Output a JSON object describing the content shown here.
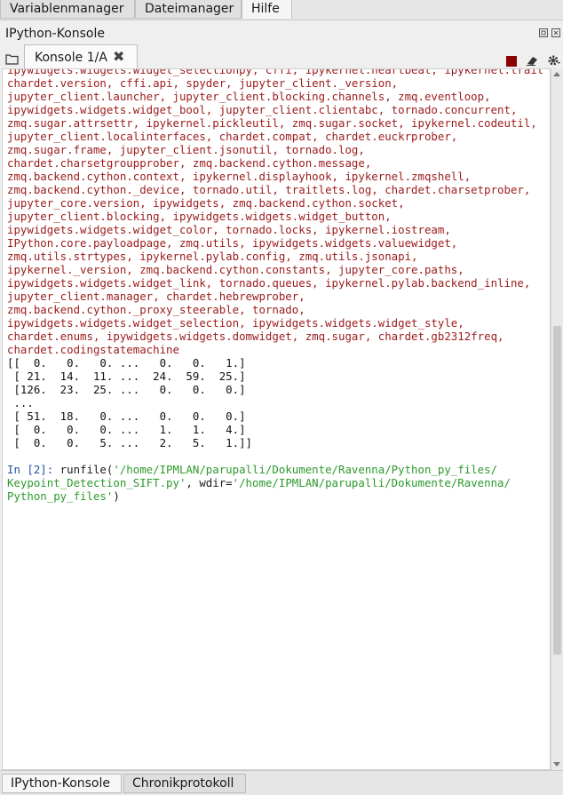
{
  "top_tabs": [
    "Variablenmanager",
    "Dateimanager",
    "Hilfe"
  ],
  "pane": {
    "title": "IPython-Konsole"
  },
  "console_tab": {
    "label": "Konsole 1/A",
    "close": "✖"
  },
  "console": {
    "import_lines": [
      "ipywidgets.widgets.widget_selectionpy, cffi, ipykernel.heartbeat, ipykernel.trait",
      "chardet.version, cffi.api, spyder, jupyter_client._version,",
      "jupyter_client.launcher, jupyter_client.blocking.channels, zmq.eventloop,",
      "ipywidgets.widgets.widget_bool, jupyter_client.clientabc, tornado.concurrent,",
      "zmq.sugar.attrsettr, ipykernel.pickleutil, zmq.sugar.socket, ipykernel.codeutil,",
      "jupyter_client.localinterfaces, chardet.compat, chardet.euckrprober,",
      "zmq.sugar.frame, jupyter_client.jsonutil, tornado.log,",
      "chardet.charsetgroupprober, zmq.backend.cython.message,",
      "zmq.backend.cython.context, ipykernel.displayhook, ipykernel.zmqshell,",
      "zmq.backend.cython._device, tornado.util, traitlets.log, chardet.charsetprober,",
      "jupyter_core.version, ipywidgets, zmq.backend.cython.socket,",
      "jupyter_client.blocking, ipywidgets.widgets.widget_button,",
      "ipywidgets.widgets.widget_color, tornado.locks, ipykernel.iostream,",
      "IPython.core.payloadpage, zmq.utils, ipywidgets.widgets.valuewidget,",
      "zmq.utils.strtypes, ipykernel.pylab.config, zmq.utils.jsonapi,",
      "ipykernel._version, zmq.backend.cython.constants, jupyter_core.paths,",
      "ipywidgets.widgets.widget_link, tornado.queues, ipykernel.pylab.backend_inline,",
      "jupyter_client.manager, chardet.hebrewprober,",
      "zmq.backend.cython._proxy_steerable, tornado,",
      "ipywidgets.widgets.widget_selection, ipywidgets.widgets.widget_style,",
      "chardet.enums, ipywidgets.widgets.domwidget, zmq.sugar, chardet.gb2312freq,",
      "chardet.codingstatemachine"
    ],
    "array_lines": [
      "[[  0.   0.   0. ...   0.   0.   1.]",
      " [ 21.  14.  11. ...  24.  59.  25.]",
      " [126.  23.  25. ...   0.   0.   0.]",
      " ...",
      " [ 51.  18.   0. ...   0.   0.   0.]",
      " [  0.   0.   0. ...   1.   1.   4.]",
      " [  0.   0.   5. ...   2.   5.   1.]]"
    ],
    "prompt": "In [2]:",
    "cmd_func": " runfile(",
    "cmd_str1a": "'/home/IPMLAN/parupalli/Dokumente/Ravenna/Python_py_files/",
    "cmd_str1b": "Keypoint_Detection_SIFT.py'",
    "cmd_mid": ", wdir=",
    "cmd_str2a": "'/home/IPMLAN/parupalli/Dokumente/Ravenna/",
    "cmd_str2b": "Python_py_files'",
    "cmd_end": ")"
  },
  "bottom_tabs": [
    "IPython-Konsole",
    "Chronikprotokoll"
  ],
  "colors": {
    "import_text": "#9b1b1b",
    "prompt": "#1f55a8",
    "string": "#2c9a2c",
    "stop_button": "#8b0000"
  }
}
